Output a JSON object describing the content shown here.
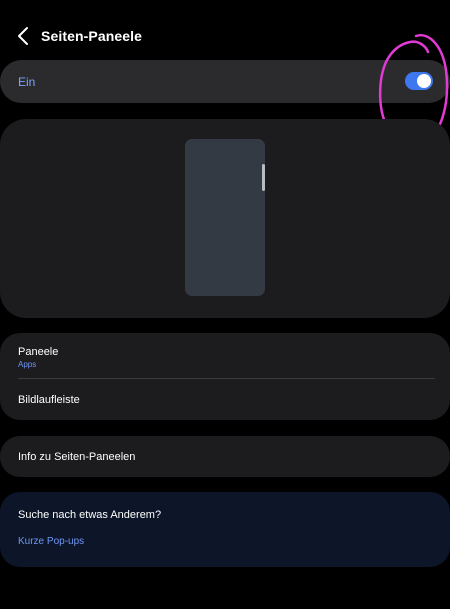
{
  "header": {
    "title": "Seiten-Paneele",
    "back_icon": "chevron-left-icon"
  },
  "master_switch": {
    "label": "Ein",
    "state": "on"
  },
  "settings_list": [
    {
      "title": "Paneele",
      "subtitle": "Apps"
    },
    {
      "title": "Bildlaufleiste"
    }
  ],
  "info_item": {
    "title": "Info zu Seiten-Paneelen"
  },
  "suggestion": {
    "title": "Suche nach etwas Anderem?",
    "link": "Kurze Pop-ups"
  },
  "colors": {
    "background": "#000000",
    "card": "#1c1c1f",
    "master_card": "#2b2b2e",
    "accent": "#3e78f0",
    "link": "#6e96f5",
    "suggestion_card": "#0c1628",
    "annotation": "#e13bd4"
  }
}
